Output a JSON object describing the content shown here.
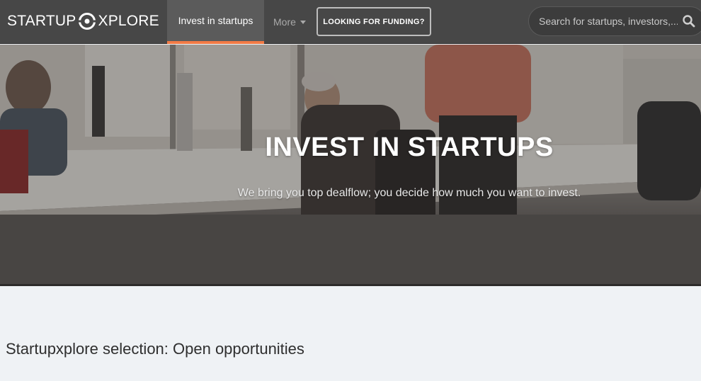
{
  "navbar": {
    "logo_left": "STARTUP",
    "logo_right": "XPLORE",
    "logo_icon": "target-o-icon",
    "invest_label": "Invest in startups",
    "more_label": "More",
    "funding_label": "LOOKING FOR FUNDING?",
    "search_placeholder": "Search for startups, investors,...",
    "search_icon": "search-icon",
    "accent_color": "#f27a45"
  },
  "hero": {
    "title": "INVEST IN STARTUPS",
    "subtitle": "We bring you top dealflow; you decide how much you want to invest."
  },
  "section": {
    "title": "Startupxplore selection: Open opportunities"
  }
}
